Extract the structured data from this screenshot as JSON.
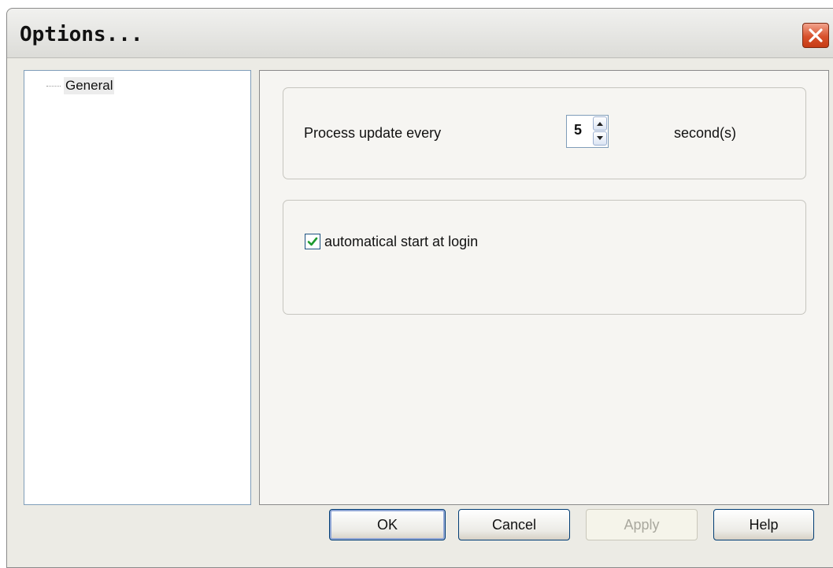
{
  "window": {
    "title": "Options..."
  },
  "tree": {
    "items": [
      {
        "label": "General"
      }
    ]
  },
  "settings": {
    "process_label": "Process update every",
    "interval_value": "5",
    "seconds_label": "second(s)",
    "autostart_label": "automatical start at login",
    "autostart_checked": true
  },
  "buttons": {
    "ok": "OK",
    "cancel": "Cancel",
    "apply": "Apply",
    "help": "Help"
  },
  "icons": {
    "close": "close-icon",
    "spin_up": "chevron-up-icon",
    "spin_down": "chevron-down-icon",
    "check": "check-icon"
  },
  "colors": {
    "close_button": "#d8512c",
    "check_mark": "#1d9a2e"
  }
}
